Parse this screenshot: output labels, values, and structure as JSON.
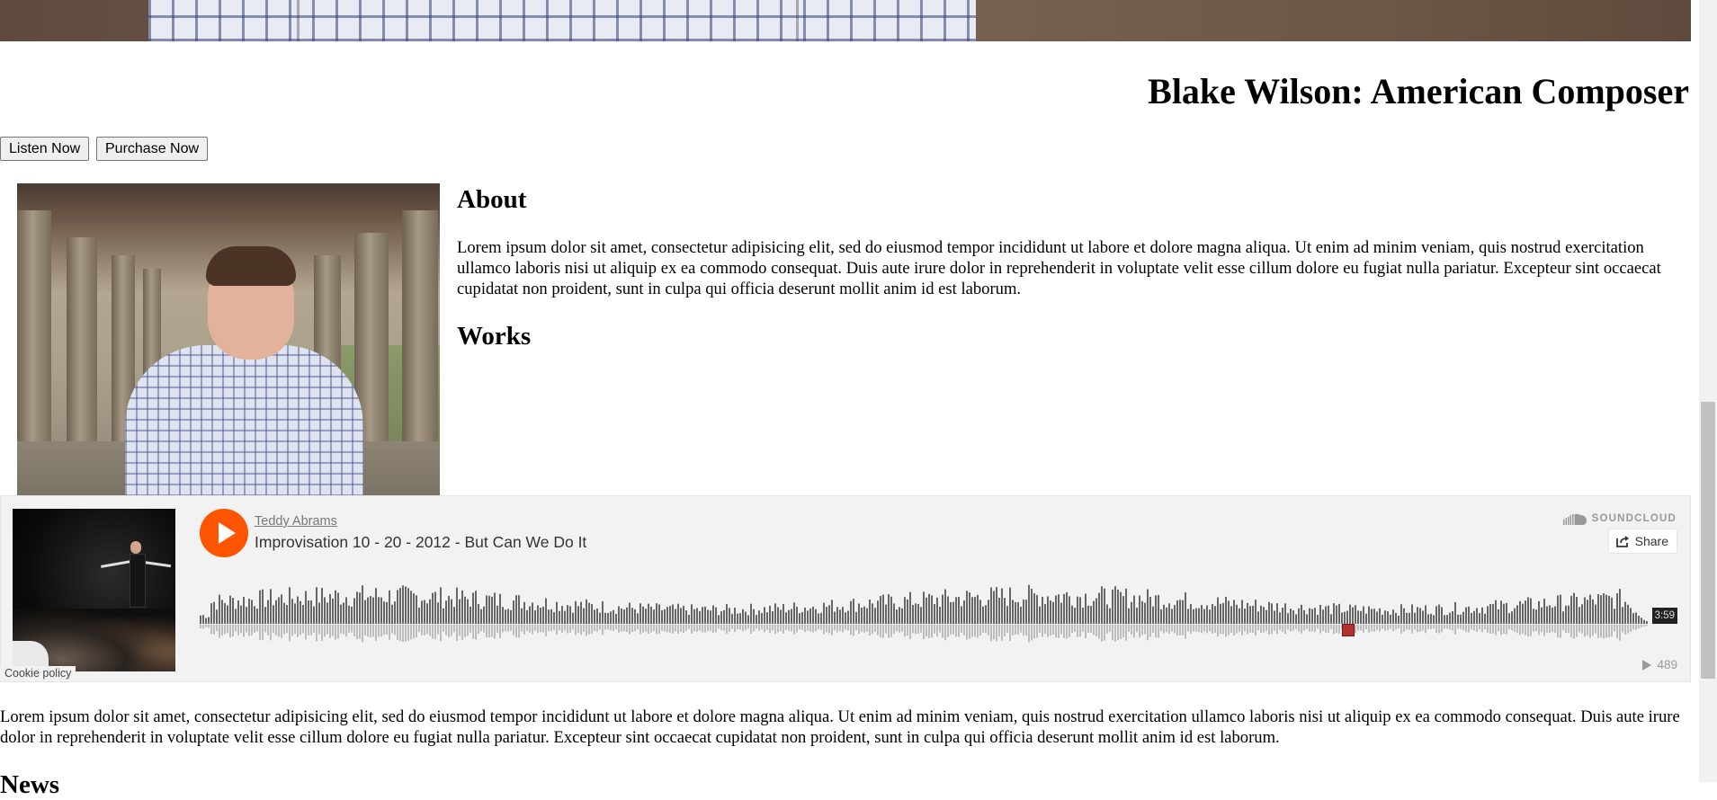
{
  "header": {
    "title": "Blake Wilson: American Composer",
    "listen_button": "Listen Now",
    "purchase_button": "Purchase Now"
  },
  "about": {
    "heading": "About",
    "text": "Lorem ipsum dolor sit amet, consectetur adipisicing elit, sed do eiusmod tempor incididunt ut labore et dolore magna aliqua. Ut enim ad minim veniam, quis nostrud exercitation ullamco laboris nisi ut aliquip ex ea commodo consequat. Duis aute irure dolor in reprehenderit in voluptate velit esse cillum dolore eu fugiat nulla pariatur. Excepteur sint occaecat cupidatat non proident, sunt in culpa qui officia deserunt mollit anim id est laborum."
  },
  "works": {
    "heading": "Works"
  },
  "soundcloud": {
    "user": "Teddy Abrams",
    "track": "Improvisation 10 - 20 - 2012 - But Can We Do It",
    "logo_text": "SOUNDCLOUD",
    "share_label": "Share",
    "duration": "3:59",
    "plays": "489",
    "cookie_policy": "Cookie policy",
    "icons": [
      "play-icon",
      "soundcloud-logo-icon",
      "share-icon",
      "plays-icon"
    ],
    "accent_color": "#ff5500"
  },
  "main": {
    "text": "Lorem ipsum dolor sit amet, consectetur adipisicing elit, sed do eiusmod tempor incididunt ut labore et dolore magna aliqua. Ut enim ad minim veniam, quis nostrud exercitation ullamco laboris nisi ut aliquip ex ea commodo consequat. Duis aute irure dolor in reprehenderit in voluptate velit esse cillum dolore eu fugiat nulla pariatur. Excepteur sint occaecat cupidatat non proident, sunt in culpa qui officia deserunt mollit anim id est laborum."
  },
  "news": {
    "heading": "News"
  }
}
